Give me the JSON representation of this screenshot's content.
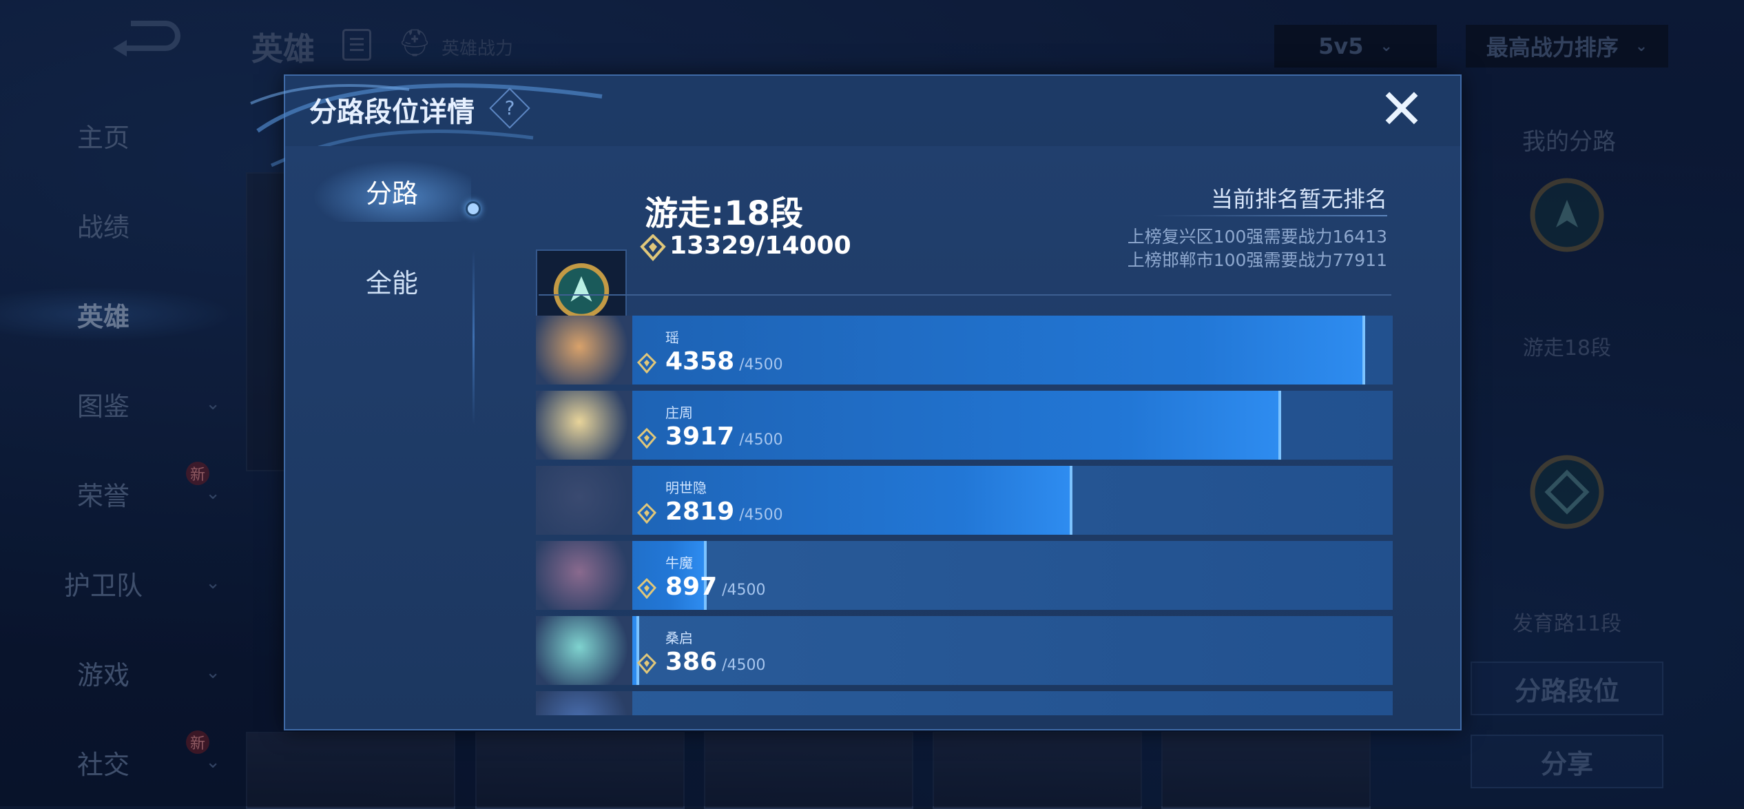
{
  "header": {
    "title": "英雄",
    "subtitle": "英雄战力",
    "mode_select": "5v5",
    "sort_select": "最高战力排序"
  },
  "nav": [
    {
      "label": "主页",
      "has_chevron": false
    },
    {
      "label": "战绩",
      "has_chevron": false
    },
    {
      "label": "英雄",
      "has_chevron": false,
      "active": true
    },
    {
      "label": "图鉴",
      "has_chevron": true
    },
    {
      "label": "荣誉",
      "has_chevron": true,
      "badge": "新"
    },
    {
      "label": "护卫队",
      "has_chevron": true
    },
    {
      "label": "游戏",
      "has_chevron": true
    },
    {
      "label": "社交",
      "has_chevron": true,
      "badge": "新"
    }
  ],
  "right_panel": {
    "title": "我的分路",
    "lanes": [
      {
        "label": "游走18段",
        "icon": "support-lane-emblem"
      },
      {
        "label": "发育路11段",
        "icon": "marksman-lane-emblem"
      }
    ],
    "lane_rank_button": "分路段位",
    "share_button": "分享"
  },
  "modal": {
    "title": "分路段位详情",
    "help": "?",
    "close": "✕",
    "tabs": [
      "分路",
      "全能"
    ],
    "lane": {
      "name": "游走:18段",
      "power": "13329",
      "power_max": "/14000",
      "rank_status": "当前排名暂无排名",
      "requirements": [
        "上榜复兴区100强需要战力16413",
        "上榜邯郸市100强需要战力77911"
      ]
    },
    "heroes": [
      {
        "name": "瑶",
        "power": "4358",
        "max": "/4500",
        "progress": 0.968,
        "tint": "#d9a26a"
      },
      {
        "name": "庄周",
        "power": "3917",
        "max": "/4500",
        "progress": 0.87,
        "tint": "#e8d49a"
      },
      {
        "name": "明世隐",
        "power": "2819",
        "max": "/4500",
        "progress": 0.626,
        "tint": "#3a4a70"
      },
      {
        "name": "牛魔",
        "power": "897",
        "max": "/4500",
        "progress": 0.199,
        "tint": "#8a6a8e"
      },
      {
        "name": "桑启",
        "power": "386",
        "max": "/4500",
        "progress": 0.086,
        "tint": "#7fd3cf"
      }
    ]
  }
}
